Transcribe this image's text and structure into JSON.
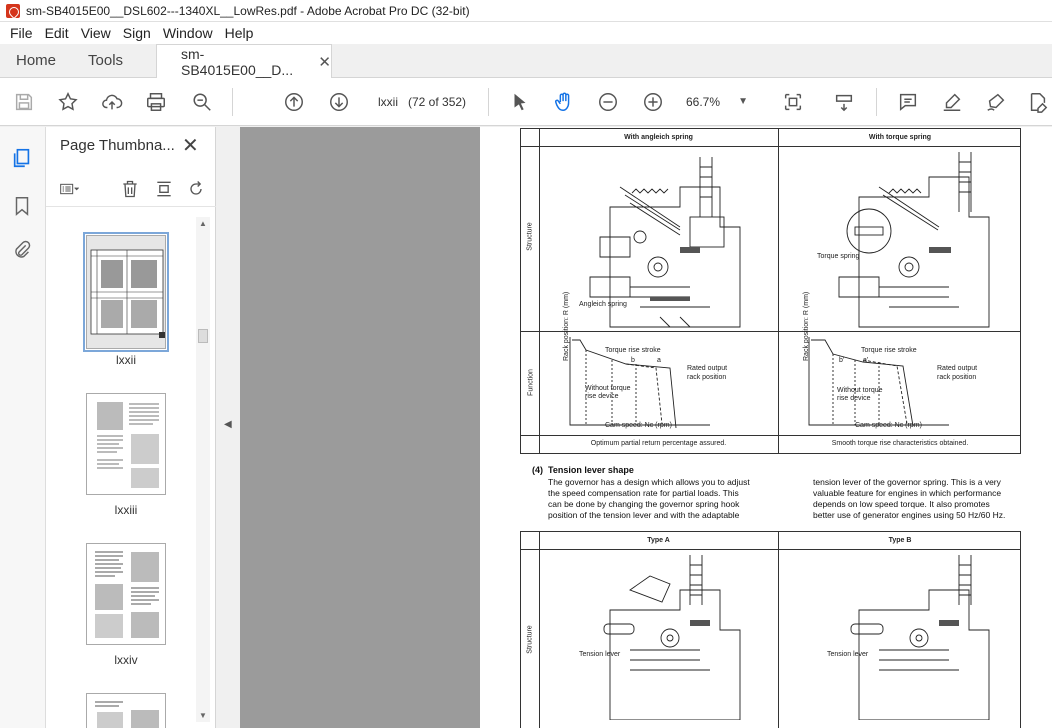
{
  "window": {
    "title": "sm-SB4015E00__DSL602---1340XL__LowRes.pdf - Adobe Acrobat Pro DC (32-bit)"
  },
  "menu": [
    "File",
    "Edit",
    "View",
    "Sign",
    "Window",
    "Help"
  ],
  "tabs": {
    "home": "Home",
    "tools": "Tools",
    "document": "sm-SB4015E00__D..."
  },
  "toolbar": {
    "page_value": "lxxii",
    "page_count": "(72 of 352)",
    "zoom": "66.7%"
  },
  "thumbnails": {
    "title": "Page Thumbna...",
    "items": [
      {
        "label": "lxxii"
      },
      {
        "label": "lxxiii"
      },
      {
        "label": "lxxiv"
      }
    ]
  },
  "document": {
    "table1": {
      "col1": "With angleich spring",
      "col2": "With torque spring",
      "row1": "Structure",
      "row2": "Function",
      "angleich_spring": "Angleich spring",
      "torque_spring": "Torque spring",
      "torque_rise_stroke": "Torque rise stroke",
      "rated_output": "Rated output",
      "rack_position": "rack position",
      "without_torque": "Without torque",
      "rise_device": "rise device",
      "y_axis": "Rack position: R (mm)",
      "x_axis": "Cam speed: Nc (rpm)",
      "b": "b",
      "a": "a",
      "b2": "b'",
      "a2": "a'",
      "caption1": "Optimum partial return percentage assured.",
      "caption2": "Smooth torque rise characteristics obtained."
    },
    "section": {
      "number": "(4)",
      "title": "Tension lever shape",
      "left_lines": [
        "The governor has a design which allows you to adjust",
        "the speed compensation rate for partial loads.  This",
        "can be done by changing the governor spring hook",
        "position of the tension lever and with the adaptable"
      ],
      "right_lines": [
        "tension lever of the governor spring.  This is a very",
        "valuable feature for engines in which performance",
        "depends on low speed torque.  It also promotes",
        "better use of generator engines using 50 Hz/60 Hz."
      ]
    },
    "table2": {
      "col1": "Type A",
      "col2": "Type B",
      "row1": "Structure",
      "tension_lever": "Tension lever"
    }
  }
}
